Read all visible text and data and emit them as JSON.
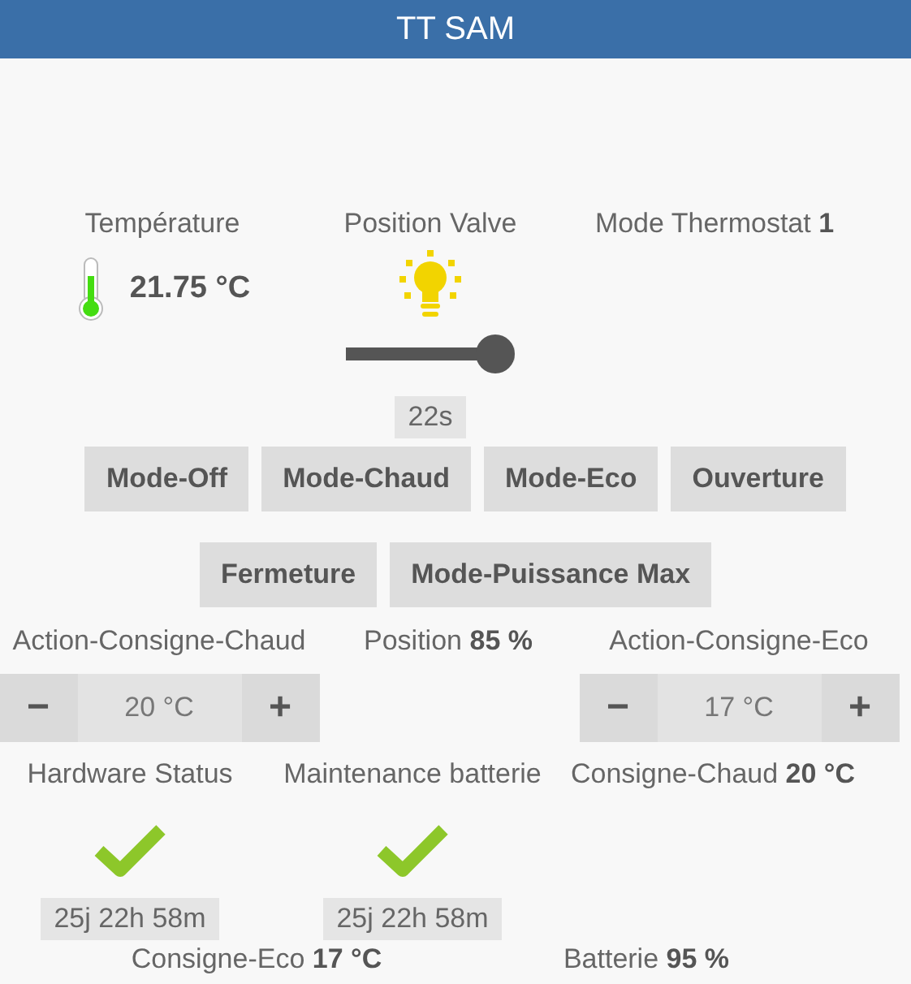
{
  "window": {
    "title": "TT SAM"
  },
  "row1": [
    {
      "kind": "temperature",
      "label": "Température",
      "value": "21.75 °C"
    },
    {
      "kind": "valve",
      "label": "Position Valve",
      "on": true,
      "level": 0.88,
      "duration": "22s"
    },
    {
      "kind": "info",
      "label": "Mode Thermostat",
      "value": "1"
    }
  ],
  "buttons_row1": [
    "Mode-Off",
    "Mode-Chaud",
    "Mode-Eco",
    "Ouverture"
  ],
  "buttons_row2": [
    "Fermeture",
    "Mode-Puissance Max"
  ],
  "row4": [
    {
      "kind": "stepper",
      "label": "Action-Consigne-Chaud",
      "minus": "−",
      "value": "20 °C",
      "plus": "+"
    },
    {
      "kind": "info",
      "label": "Position",
      "value": "85 %"
    },
    {
      "kind": "stepper",
      "label": "Action-Consigne-Eco",
      "minus": "−",
      "value": "17 °C",
      "plus": "+"
    }
  ],
  "row5": [
    {
      "kind": "status",
      "label": "Hardware Status",
      "ok": true,
      "duration": "25j 22h 58m"
    },
    {
      "kind": "status",
      "label": "Maintenance batterie",
      "ok": true,
      "duration": "25j 22h 58m"
    },
    {
      "kind": "info",
      "label": "Consigne-Chaud",
      "value": "20 °C"
    }
  ],
  "row6": [
    {
      "kind": "info",
      "label": "Consigne-Eco",
      "value": "17 °C"
    },
    {
      "kind": "info",
      "label": "Batterie",
      "value": "95 %"
    }
  ]
}
